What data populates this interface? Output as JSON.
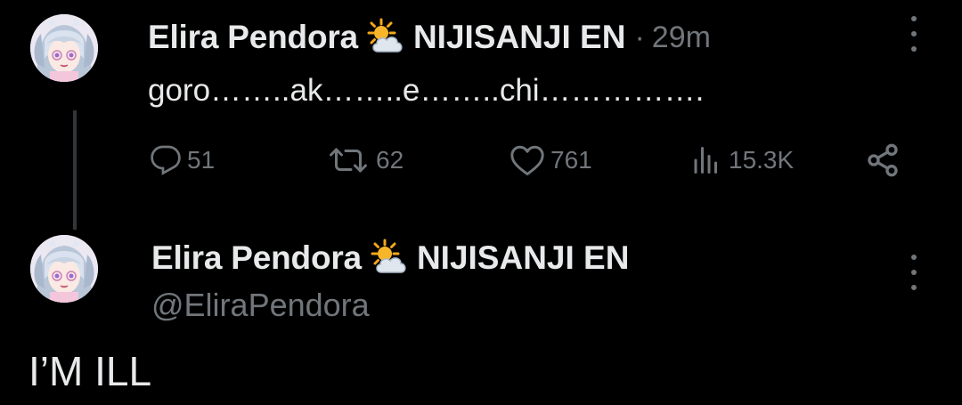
{
  "tweet1": {
    "display_name": "Elira Pendora",
    "badge_icon": "sun-behind-cloud-icon",
    "suffix": "NIJISANJI EN",
    "separator": "·",
    "time": "29m",
    "text": "goro……..ak……..e……..chi…………….",
    "actions": {
      "replies": "51",
      "reposts": "62",
      "likes": "761",
      "views": "15.3K"
    }
  },
  "tweet2": {
    "display_name": "Elira Pendora",
    "badge_icon": "sun-behind-cloud-icon",
    "suffix": "NIJISANJI EN",
    "handle": "@EliraPendora",
    "text": "I’M ILL"
  },
  "colors": {
    "background": "#000000",
    "primary_text": "#e7e9ea",
    "secondary_text": "#71767b",
    "thread_line": "#333639"
  }
}
